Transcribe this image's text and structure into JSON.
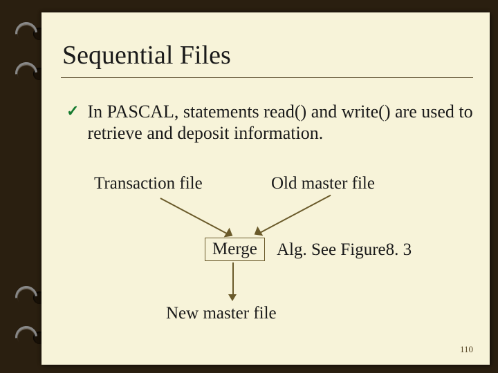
{
  "title": "Sequential Files",
  "bullet": "In PASCAL, statements read() and write() are used to retrieve and deposit information.",
  "labels": {
    "transaction": "Transaction file",
    "oldmaster": "Old master file",
    "merge": "Merge",
    "alg": "Alg. See Figure8. 3",
    "newmaster": "New master file"
  },
  "page": "110"
}
